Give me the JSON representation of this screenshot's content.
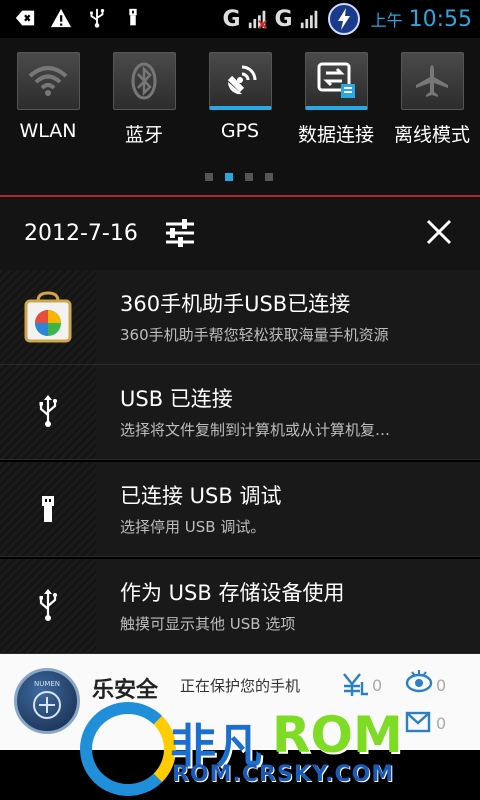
{
  "status_bar": {
    "network_a": "G",
    "network_b": "G",
    "ampm": "上午",
    "time": "10:55"
  },
  "quick_toggles": [
    {
      "label": "WLAN",
      "icon": "wifi-icon",
      "on": false
    },
    {
      "label": "蓝牙",
      "icon": "bluetooth-icon",
      "on": false
    },
    {
      "label": "GPS",
      "icon": "gps-icon",
      "on": true
    },
    {
      "label": "数据连接",
      "icon": "data-connection-icon",
      "on": true
    },
    {
      "label": "离线模式",
      "icon": "airplane-icon",
      "on": false
    }
  ],
  "pager": {
    "count": 4,
    "active": 1
  },
  "header": {
    "date": "2012-7-16"
  },
  "notifications": [
    {
      "title": "360手机助手USB已连接",
      "sub": "360手机助手帮您轻松获取海量手机资源",
      "icon": "360-assistant-icon"
    },
    {
      "title": "USB 已连接",
      "sub": "选择将文件复制到计算机或从计算机复…",
      "icon": "usb-icon"
    },
    {
      "title": "已连接 USB 调试",
      "sub": "选择停用 USB 调试。",
      "icon": "usb-debug-icon"
    },
    {
      "title": "作为 USB 存储设备使用",
      "sub": "触摸可显示其他 USB 选项",
      "icon": "usb-icon"
    }
  ],
  "widget": {
    "badge_text": "NUMEN",
    "name": "乐安全",
    "status": "正在保护您的手机",
    "count_a": "0",
    "count_b": "0",
    "count_c": "0"
  },
  "watermark": {
    "cn": "非凡",
    "rom": "ROM",
    "url": "ROM.CRSKY.COM"
  },
  "colors": {
    "accent": "#29a9e1",
    "divider": "#b0282a"
  }
}
